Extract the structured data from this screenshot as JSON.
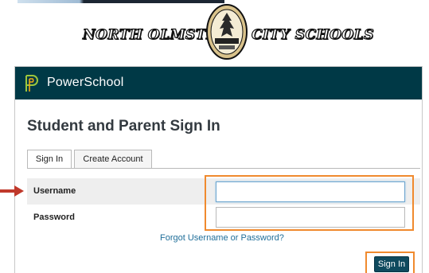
{
  "banner": {
    "left_text": "NORTH OLMSTED",
    "right_text": "CITY SCHOOLS"
  },
  "app": {
    "name": "PowerSchool"
  },
  "page": {
    "title": "Student and Parent Sign In"
  },
  "tabs": [
    {
      "label": "Sign In",
      "active": true
    },
    {
      "label": "Create Account",
      "active": false
    }
  ],
  "form": {
    "username_label": "Username",
    "username_value": "",
    "password_label": "Password",
    "password_value": "",
    "forgot_link": "Forgot Username or Password?",
    "submit_label": "Sign In"
  },
  "colors": {
    "header_bg": "#003946",
    "accent_orange": "#f08a2e",
    "annotation_arrow": "#c0392b",
    "button_bg": "#0f4a5e",
    "link": "#1f6e99"
  },
  "icons": {
    "app_logo": "powerschool-logo-icon",
    "district_seal": "eagle-seal-icon",
    "pointer": "arrow-right-icon"
  }
}
